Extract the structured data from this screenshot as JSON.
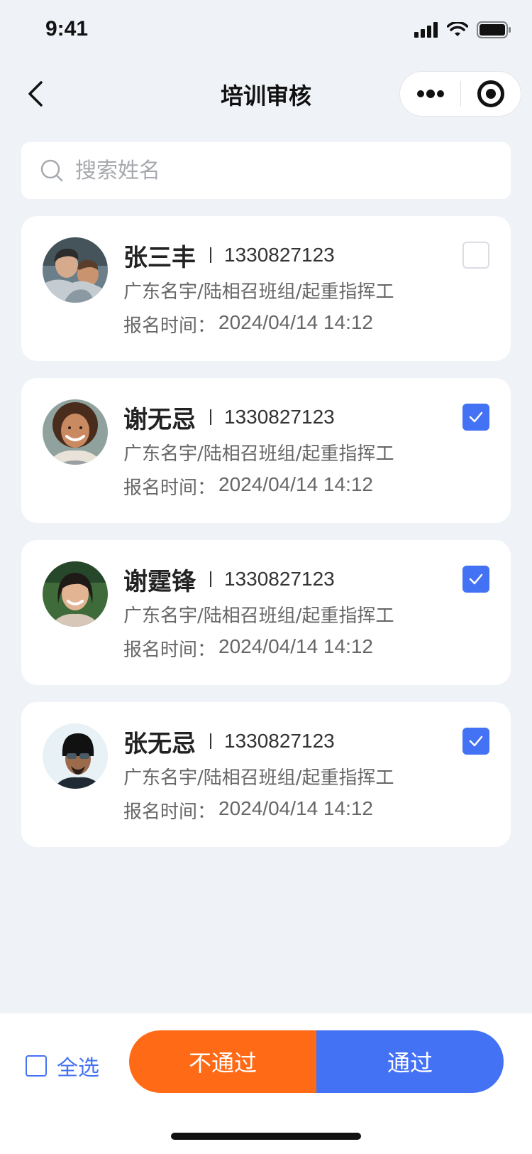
{
  "status_bar": {
    "time": "9:41"
  },
  "nav": {
    "title": "培训审核",
    "back_icon": "chevron-left-icon",
    "more_icon": "more-dots-icon",
    "close_icon": "target-icon"
  },
  "search": {
    "placeholder": "搜索姓名",
    "value": "",
    "icon": "search-icon"
  },
  "applicants": [
    {
      "name": "张三丰",
      "phone": "1330827123",
      "org": "广东名宇/陆相召班组/起重指挥工",
      "reg_label": "报名时间：",
      "reg_time": "2024/04/14 14:12",
      "checked": false
    },
    {
      "name": "谢无忌",
      "phone": "1330827123",
      "org": "广东名宇/陆相召班组/起重指挥工",
      "reg_label": "报名时间：",
      "reg_time": "2024/04/14 14:12",
      "checked": true
    },
    {
      "name": "谢霆锋",
      "phone": "1330827123",
      "org": "广东名宇/陆相召班组/起重指挥工",
      "reg_label": "报名时间：",
      "reg_time": "2024/04/14 14:12",
      "checked": true
    },
    {
      "name": "张无忌",
      "phone": "1330827123",
      "org": "广东名宇/陆相召班组/起重指挥工",
      "reg_label": "报名时间：",
      "reg_time": "2024/04/14 14:12",
      "checked": true
    }
  ],
  "footer": {
    "select_all_label": "全选",
    "select_all_checked": false,
    "reject_label": "不通过",
    "pass_label": "通过"
  },
  "colors": {
    "accent": "#4472f5",
    "reject": "#ff6a16",
    "background": "#eff2f7"
  }
}
